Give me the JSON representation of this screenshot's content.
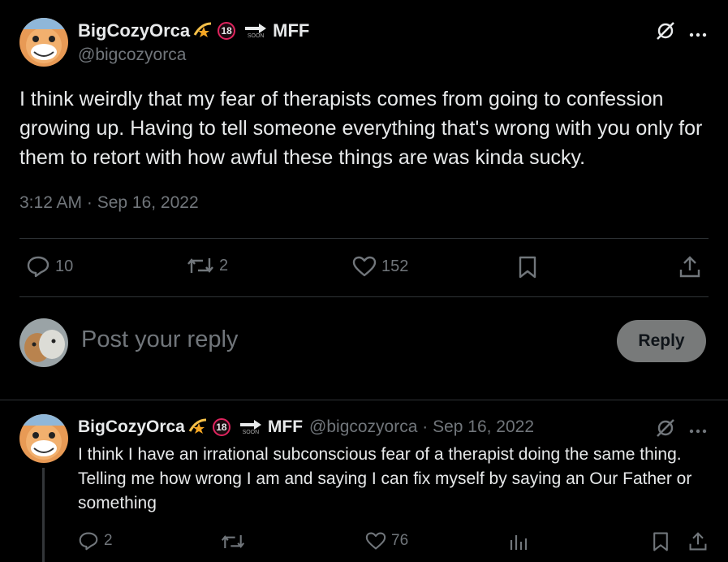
{
  "main_tweet": {
    "display_name": "BigCozyOrca",
    "badge_18": "18",
    "soon_label": "SOON",
    "suffix": "MFF",
    "handle": "@bigcozyorca",
    "text": "I think weirdly that my fear of therapists comes from going to confession growing up. Having to tell someone everything that's wrong with you only for them to retort with how awful these things are was kinda sucky.",
    "timestamp": "3:12 AM · Sep 16, 2022",
    "stats": {
      "replies": "10",
      "retweets": "2",
      "likes": "152"
    }
  },
  "reply_box": {
    "placeholder": "Post your reply",
    "button": "Reply"
  },
  "reply_tweet": {
    "display_name": "BigCozyOrca",
    "badge_18": "18",
    "soon_label": "SOON",
    "suffix": "MFF",
    "handle_date": "@bigcozyorca · Sep 16, 2022",
    "text": "I think I have an irrational subconscious fear of a therapist doing the same thing. Telling me how wrong I am and saying I can fix myself by saying an Our Father or something",
    "stats": {
      "replies": "2",
      "likes": "76"
    }
  },
  "colors": {
    "background": "#000000",
    "text": "#e7e9ea",
    "muted": "#71767b",
    "divider": "#2f3336"
  }
}
